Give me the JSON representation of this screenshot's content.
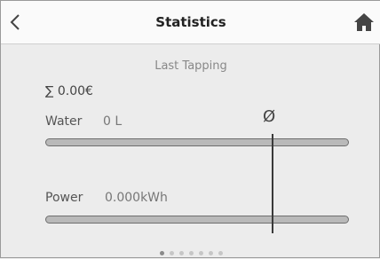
{
  "header": {
    "title": "Statistics"
  },
  "view": {
    "subtitle": "Last Tapping",
    "total": "∑ 0.00€",
    "average_symbol": "Ø"
  },
  "water": {
    "label": "Water",
    "value": "0 L"
  },
  "power": {
    "label": "Power",
    "value": "0.000kWh"
  },
  "pager": {
    "count": 7,
    "active_index": 0
  },
  "colors": {
    "header_bg": "#fafafa",
    "body_bg": "#ececec",
    "bar_fill": "#b9b9b9",
    "marker": "#3a3a3a"
  }
}
